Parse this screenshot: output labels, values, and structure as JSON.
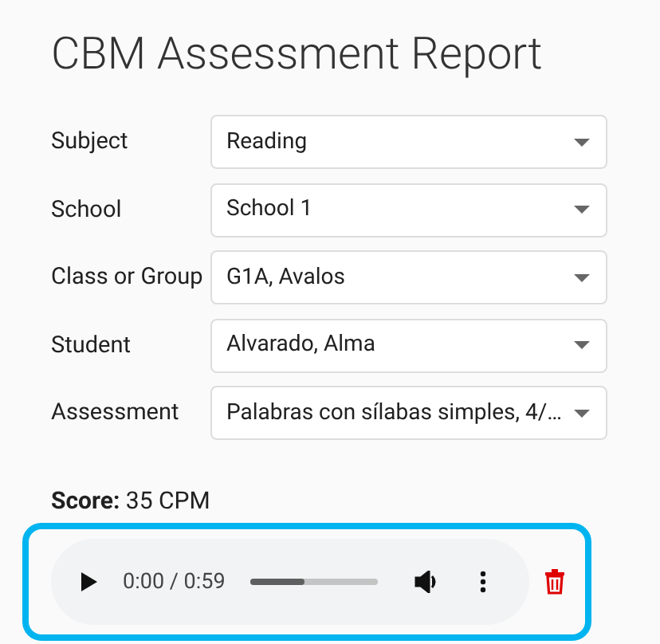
{
  "title": "CBM Assessment Report",
  "fields": [
    {
      "label": "Subject",
      "value": "Reading"
    },
    {
      "label": "School",
      "value": "School 1"
    },
    {
      "label": "Class or Group",
      "value": "G1A, Avalos"
    },
    {
      "label": "Student",
      "value": "Alvarado, Alma"
    },
    {
      "label": "Assessment",
      "value": "Palabras con sílabas simples, 4/…"
    }
  ],
  "score": {
    "label": "Score:",
    "value": "35 CPM"
  },
  "audio": {
    "time": "0:00 / 0:59",
    "level": 0.42
  }
}
